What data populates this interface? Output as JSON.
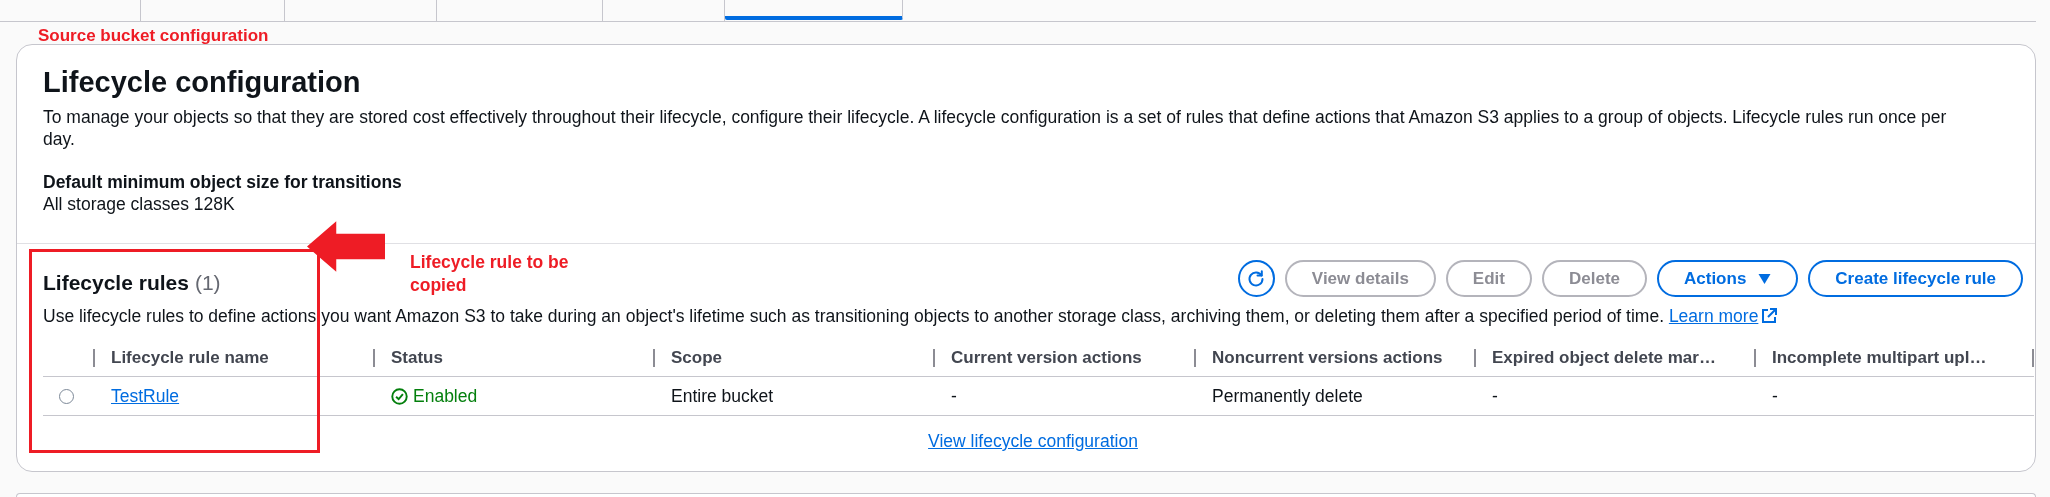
{
  "tabs": [
    {
      "selected": false
    },
    {
      "selected": false
    },
    {
      "selected": false
    },
    {
      "selected": false
    },
    {
      "selected": false
    },
    {
      "selected": true
    }
  ],
  "annotations": {
    "title": "Source bucket configuration",
    "callout": "Lifecycle rule to be copied"
  },
  "lifecycle_configuration": {
    "title": "Lifecycle configuration",
    "description": "To manage your objects so that they are stored cost effectively throughout their lifecycle, configure their lifecycle. A lifecycle configuration is a set of rules that define actions that Amazon S3 applies to a group of objects. Lifecycle rules run once per day.",
    "min_size_label": "Default minimum object size for transitions",
    "min_size_value": "All storage classes 128K"
  },
  "lifecycle_rules": {
    "title": "Lifecycle rules",
    "count": "(1)",
    "buttons": [
      {
        "kind": "refresh",
        "disabled": false
      },
      {
        "kind": "normal",
        "label": "View details",
        "disabled": true
      },
      {
        "kind": "normal",
        "label": "Edit",
        "disabled": true
      },
      {
        "kind": "normal",
        "label": "Delete",
        "disabled": true
      },
      {
        "kind": "dropdown",
        "label": "Actions",
        "disabled": false
      },
      {
        "kind": "normal",
        "label": "Create lifecycle rule",
        "disabled": false
      }
    ],
    "description": "Use lifecycle rules to define actions you want Amazon S3 to take during an object's lifetime such as transitioning objects to another storage class, archiving them, or deleting them after a specified period of time.",
    "learn_more": "Learn more",
    "columns": [
      "Lifecycle rule name",
      "Status",
      "Scope",
      "Current version actions",
      "Noncurrent versions actions",
      "Expired object delete mar…",
      "Incomplete multipart upl…"
    ],
    "rows": [
      {
        "selected": false,
        "cells": [
          {
            "kind": "link",
            "text": "TestRule"
          },
          {
            "kind": "status",
            "text": "Enabled"
          },
          {
            "kind": "text",
            "text": "Entire bucket"
          },
          {
            "kind": "text",
            "text": "-"
          },
          {
            "kind": "text",
            "text": "Permanently delete"
          },
          {
            "kind": "text",
            "text": "-"
          },
          {
            "kind": "text",
            "text": "-"
          }
        ]
      }
    ],
    "footer_link": "View lifecycle configuration"
  }
}
